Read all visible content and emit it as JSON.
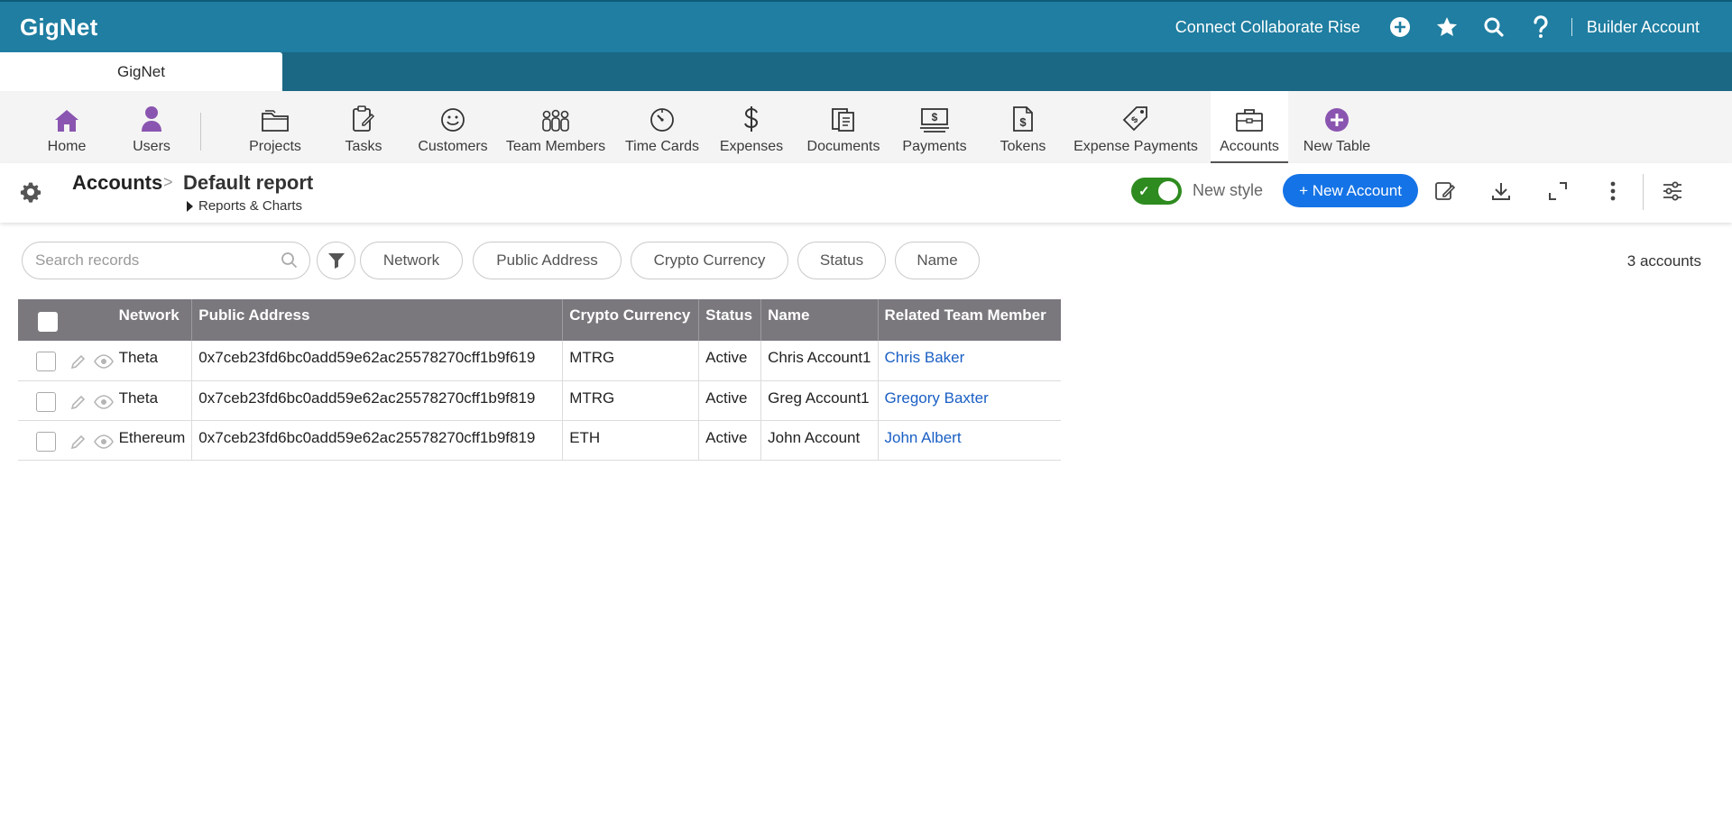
{
  "app": {
    "brand": "GigNet",
    "tagline": "Connect Collaborate Rise",
    "account": "Builder Account",
    "tab_label": "GigNet"
  },
  "nav": {
    "items": [
      {
        "label": "Home",
        "icon": "home-icon"
      },
      {
        "label": "Users",
        "icon": "user-icon"
      },
      {
        "label": "Projects",
        "icon": "folder-icon"
      },
      {
        "label": "Tasks",
        "icon": "task-icon"
      },
      {
        "label": "Customers",
        "icon": "smiley-icon"
      },
      {
        "label": "Team Members",
        "icon": "team-icon"
      },
      {
        "label": "Time Cards",
        "icon": "clock-icon"
      },
      {
        "label": "Expenses",
        "icon": "dollar-icon"
      },
      {
        "label": "Documents",
        "icon": "documents-icon"
      },
      {
        "label": "Payments",
        "icon": "payment-icon"
      },
      {
        "label": "Tokens",
        "icon": "token-icon"
      },
      {
        "label": "Expense Payments",
        "icon": "tag-icon"
      },
      {
        "label": "Accounts",
        "icon": "briefcase-icon"
      },
      {
        "label": "New Table",
        "icon": "plus-circle-icon"
      }
    ],
    "active": "Accounts"
  },
  "header": {
    "table_name": "Accounts",
    "separator": ">",
    "report_name": "Default report",
    "reports_link": "Reports & Charts",
    "toggle_label": "New style",
    "toggle_on": true,
    "new_button": "+ New Account"
  },
  "filters": {
    "search_placeholder": "Search records",
    "chips": [
      "Network",
      "Public Address",
      "Crypto Currency",
      "Status",
      "Name"
    ],
    "count": "3 accounts"
  },
  "table": {
    "columns": [
      "Network",
      "Public Address",
      "Crypto Currency",
      "Status",
      "Name",
      "Related Team Member"
    ],
    "rows": [
      {
        "network": "Theta",
        "address": "0x7ceb23fd6bc0add59e62ac25578270cff1b9f619",
        "currency": "MTRG",
        "status": "Active",
        "name": "Chris Account1",
        "member": "Chris Baker"
      },
      {
        "network": "Theta",
        "address": "0x7ceb23fd6bc0add59e62ac25578270cff1b9f819",
        "currency": "MTRG",
        "status": "Active",
        "name": "Greg Account1",
        "member": "Gregory Baxter"
      },
      {
        "network": "Ethereum",
        "address": "0x7ceb23fd6bc0add59e62ac25578270cff1b9f819",
        "currency": "ETH",
        "status": "Active",
        "name": "John Account",
        "member": "John Albert"
      }
    ]
  },
  "colors": {
    "topbar": "#1f7ea1",
    "tabstrip": "#1b6884",
    "accent_purple": "#8a55b0",
    "primary_button": "#1473e6",
    "toggle_on": "#2e8b1f",
    "table_header": "#7a787d",
    "link": "#1a5fc4"
  }
}
